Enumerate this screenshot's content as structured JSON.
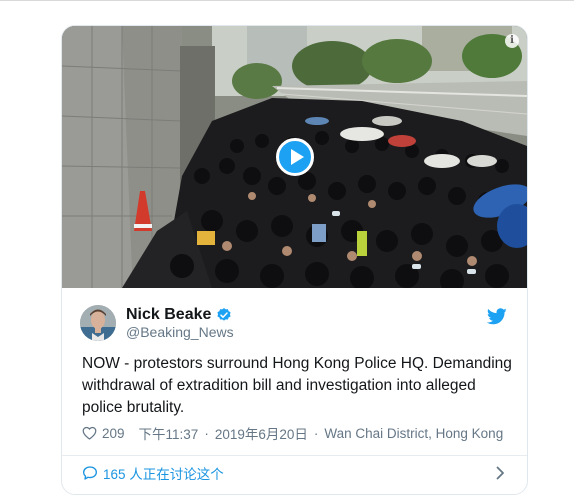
{
  "tweet": {
    "author_name": "Nick Beake",
    "handle": "@Beaking_News",
    "text": "NOW - protestors surround Hong Kong Police HQ. Demanding withdrawal of extradition bill and investigation into alleged police brutality.",
    "likes": "209",
    "time": "下午11:37",
    "date": "2019年6月20日",
    "location": "Wan Chai District, Hong Kong",
    "separator": "·",
    "discussion": "165 人正在讨论这个"
  },
  "media": {
    "type": "video",
    "subject": "crowd of protestors in black outside Hong Kong Police HQ"
  },
  "icons": {
    "info": "info-icon",
    "play": "play-icon",
    "verified": "verified-badge-icon",
    "brand": "twitter-bird-icon",
    "like": "heart-icon",
    "reply": "speech-bubble-icon",
    "more": "chevron-right-icon"
  },
  "colors": {
    "accent": "#1da1f2",
    "link": "#1b95e0",
    "text": "#14171a",
    "muted": "#657786",
    "border": "#e1e8ed"
  }
}
